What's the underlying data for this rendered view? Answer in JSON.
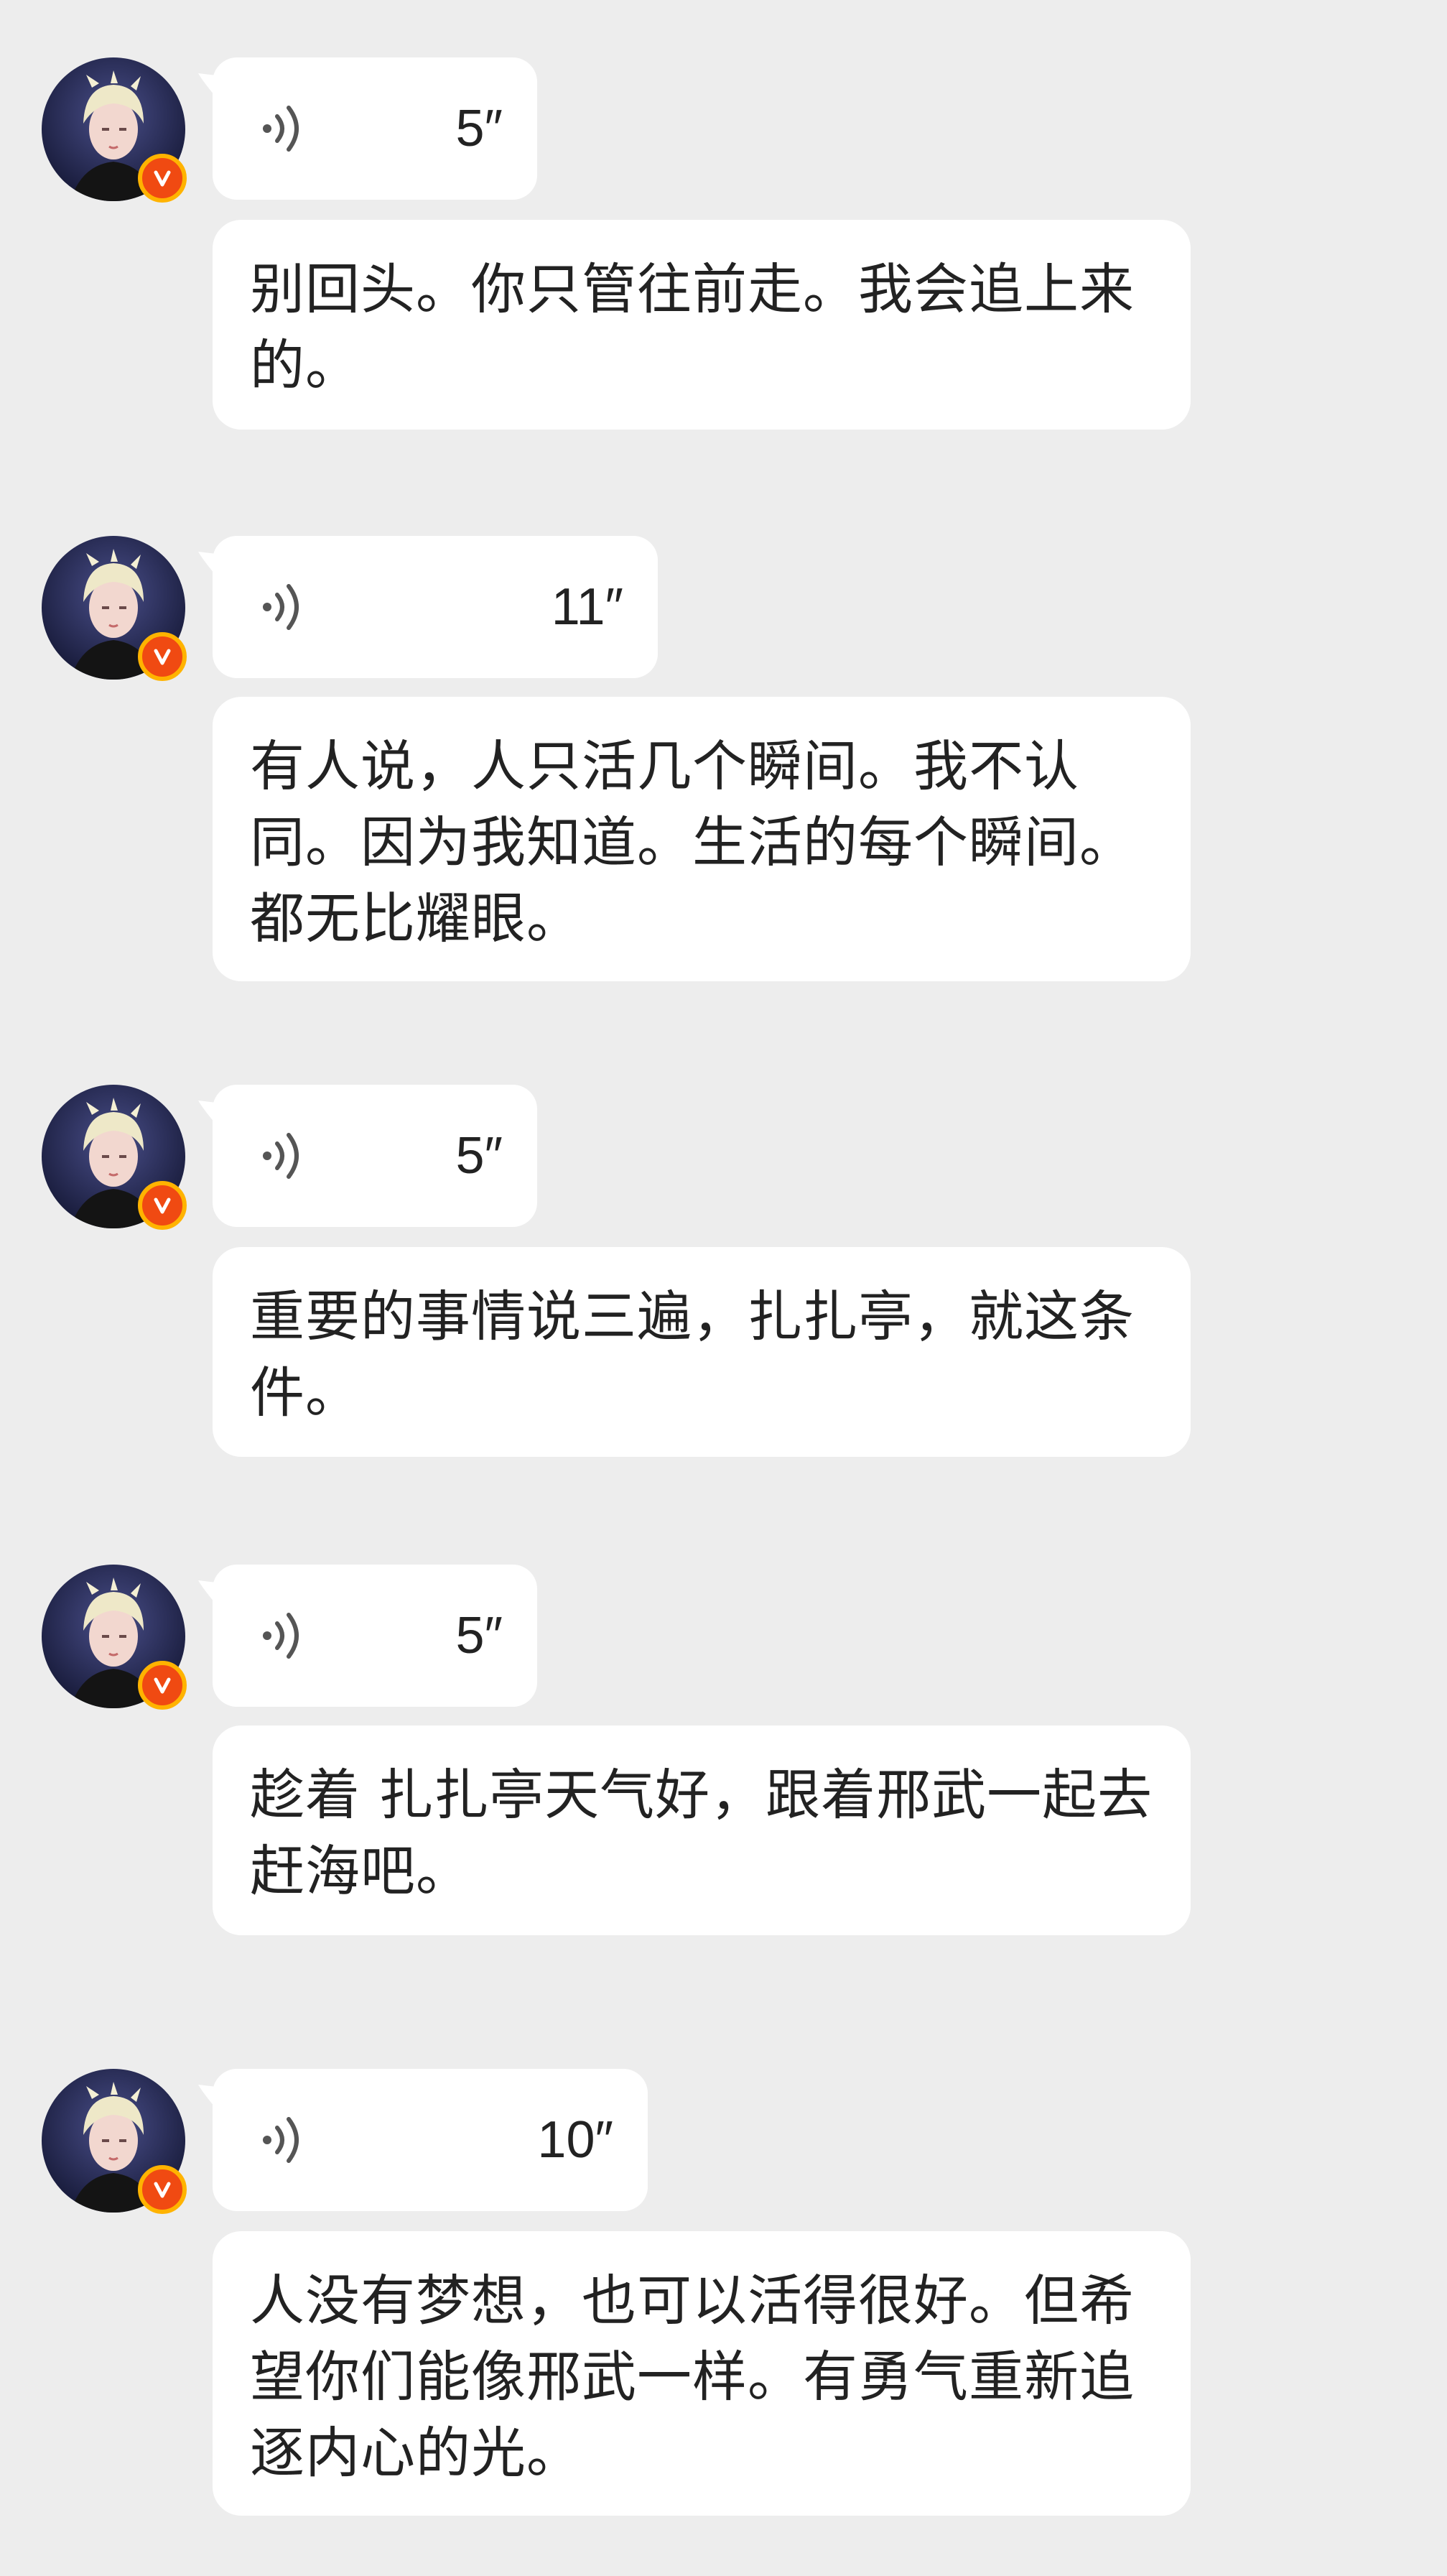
{
  "messages": [
    {
      "duration": "5″",
      "text": "别回头。你只管往前走。我会追上来的。"
    },
    {
      "duration": "11″",
      "text": "有人说，人只活几个瞬间。我不认同。因为我知道。生活的每个瞬间。都无比耀眼。"
    },
    {
      "duration": "5″",
      "text": "重要的事情说三遍，扎扎亭，就这条件。"
    },
    {
      "duration": "5″",
      "text": "趁着 扎扎亭天气好，跟着邢武一起去赶海吧。"
    },
    {
      "duration": "10″",
      "text": "人没有梦想，也可以活得很好。但希望你们能像邢武一样。有勇气重新追逐内心的光。"
    }
  ],
  "icons": {
    "avatar": "avatar-portrait",
    "badge": "verified-v-icon",
    "voice": "voice-wave-icon"
  },
  "colors": {
    "background": "#ededed",
    "bubble": "#ffffff",
    "text": "#222222",
    "badge_fill": "#f04a12",
    "badge_ring": "#ffb300"
  }
}
